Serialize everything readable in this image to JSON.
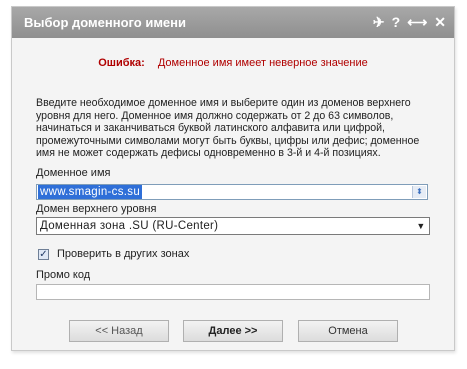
{
  "dialog": {
    "title": "Выбор доменного имени",
    "controls": {
      "pin": "✈",
      "help": "?",
      "maximize": "⟷",
      "close": "✕"
    }
  },
  "error": {
    "label": "Ошибка:",
    "message": "Доменное имя имеет неверное значение"
  },
  "hint": "Введите необходимое доменное имя и выберите один из доменов верхнего уровня для него. Доменное имя должно содержать от 2 до 63 символов, начинаться и заканчиваться буквой латинского алфавита или цифрой, промежуточными символами могут быть буквы, цифры или дефис; доменное имя не может содержать дефисы одновременно в 3-й и 4-й позициях.",
  "domain": {
    "label": "Доменное имя",
    "value": "www.smagin-cs.su"
  },
  "tld": {
    "label": "Домен верхнего уровня",
    "selected": "Доменная зона .SU (RU-Center)"
  },
  "check_other": {
    "label": "Проверить в других зонах",
    "checked": true
  },
  "promo": {
    "label": "Промо код",
    "value": ""
  },
  "buttons": {
    "back": "<< Назад",
    "next": "Далее >>",
    "cancel": "Отмена"
  }
}
